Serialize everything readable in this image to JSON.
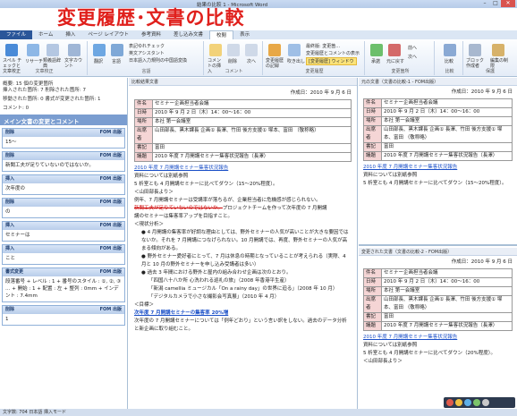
{
  "banner": {
    "title": "変更履歴･文書の比較"
  },
  "window": {
    "title": "結果の比較 1 - Microsoft Word"
  },
  "tabs": [
    "ファイル",
    "ホーム",
    "挿入",
    "ページ レイアウト",
    "参考資料",
    "差し込み文書",
    "校閲",
    "表示"
  ],
  "ribbon": {
    "groups": [
      "文章校正",
      "言語",
      "コメント",
      "変更履歴",
      "変更箇所",
      "比較",
      "保護"
    ],
    "items": {
      "spelling": "スペル チェックと文章校正",
      "research": "リサーチ",
      "thesaurus": "類義語辞典",
      "wordcount": "文字カウント",
      "translate": "翻訳",
      "language": "言語",
      "ime_check": "表記ゆれチェック",
      "translate_assist": "英文アシスタント",
      "jp_zh": "日本語入力規則の中国語変換",
      "new_comment": "コメントの挿入",
      "delete": "削除",
      "prev": "前へ",
      "next": "次へ",
      "track": "変更履歴の記録",
      "balloon": "吹き出し",
      "final_changes": "最終版: 変更箇…",
      "show_markup": "変更履歴とコメントの表示",
      "review_window": "[変更履歴] ウィンドウ",
      "accept": "承諾",
      "reject": "元に戻す",
      "prev_change": "前へ",
      "next_change": "次へ",
      "compare": "比較",
      "block": "ブロック作成者",
      "restrict": "編集の制限"
    }
  },
  "left": {
    "summary": "概要: 15 個の変更箇所",
    "lines": [
      "挿入された箇所: 7 削除された箇所: 7",
      "移動された箇所: 0 書式が変更された箇所: 1",
      "コメント: 0"
    ],
    "section": "メイン文書の変更とコメント",
    "revisions": [
      {
        "type": "削除",
        "author": "FOM 出版",
        "text": "15～"
      },
      {
        "type": "削除",
        "author": "FOM 出版",
        "text": "新聞工夫が足りていないのではないか。"
      },
      {
        "type": "挿入",
        "author": "FOM 出版",
        "text": "次年度の"
      },
      {
        "type": "削除",
        "author": "FOM 出版",
        "text": "の"
      },
      {
        "type": "挿入",
        "author": "FOM 出版",
        "text": "セミナーは"
      },
      {
        "type": "挿入",
        "author": "FOM 出版",
        "text": "こと"
      },
      {
        "type": "書式変更",
        "author": "FOM 出版",
        "text": "段落番号 + レベル : 1 + 番号のスタイル : ①, ②, ③ … + 開始 : 1 + 配置 : 左 + 整列 : 0mm + インデント : 7.4mm"
      },
      {
        "type": "削除",
        "author": "FOM 出版",
        "text": "1"
      }
    ]
  },
  "middle": {
    "pane_title": "比較結果文書",
    "created": "作成日：2010 年 9 月 6 日",
    "table": [
      [
        "件名",
        "セミナー企画担当者会議"
      ],
      [
        "日時",
        "2010 年 9 月 2 日（木）14：00～16：00"
      ],
      [
        "場所",
        "本社 第一会議室"
      ],
      [
        "出席者",
        "山田部長、黒木課長 企画① 長澤、竹田 後方支援① 塚本、富田 （敬称略）"
      ],
      [
        "書記",
        "富田"
      ],
      [
        "議題",
        "2010 年度 7 月開講セミナー集客状況報告（長澤）"
      ]
    ],
    "p1": "2010 年度 7 月開講セミナー集客状況報告",
    "p2": "資料については別紙参照",
    "p3": "5 析室とも 4 月開講セミナーに比べてダウン（15～20%程度）。",
    "p4": "＜山田部長より＞",
    "p5": "例年、7 月開講セミナーは受講率が落ちるが、企業担当者に危機感が感じられない。",
    "p6_del": "新聞工夫が足りていないのではないか。",
    "p6_rest": "プロジェクトチームを作って次年度の 7 月開講",
    "p7": "講のセミナーは集客率アップを目指すこと。",
    "p8": "＜現状分析＞",
    "bullets": [
      "4 月開講の集客率が好調な理由としては、野外セミナーの人気が高いことが大きな要因ではないか。それを 7 月開講につなげられない。10 月開講では、再度、野外セミナーの人気が高まる傾向がある。",
      "野外セミナー愛好者にとって、7 月は休息の時期となっていることが考えられる（実際、4 月と 10 月の野外セミナーを申し込み受講者は多い）",
      "過去 3 年間における野外と屋内の組み合わせ企画は次のとおり。"
    ],
    "sub": [
      "「四国八十八か所 心洗われる巡礼の旅」（2008 年香港平生産）",
      "「新潟 camellia ミュージカル「On a rainy day」の世界に迫る」（2008 年 10 月）",
      "「デジタルカメラで小さな撮影会写真展」（2010 年 4 月）"
    ],
    "p9": "＜目標＞",
    "p10": "次年度 7 月開講セミナーの集客率 20%増",
    "p11": "次年度の 7 月開講セミナーについては「例年どおり」という言い訳をしない。過去のデータ分析と新企画に取り組むこと。"
  },
  "right": {
    "top_title": "元の文書（文書の比較-1 - FOM出版）",
    "bot_title": "変更された文書（文書の比較-2 - FOM出版）",
    "created": "作成日：2010 年 9 月 6 日",
    "p1": "2010 年度 7 月開講セミナー集客状況報告",
    "p2": "資料については別紙参照",
    "p3_top": "5 析室とも 4 月開講セミナーに比べてダウン（15～20%程度）。",
    "p3_bot": "5 析室とも 4 月開講セミナーに比べてダウン（20%程度）。",
    "p4": "＜山田部長より＞"
  },
  "status": {
    "text": "文字数: 704   日本語   挿入モード"
  }
}
